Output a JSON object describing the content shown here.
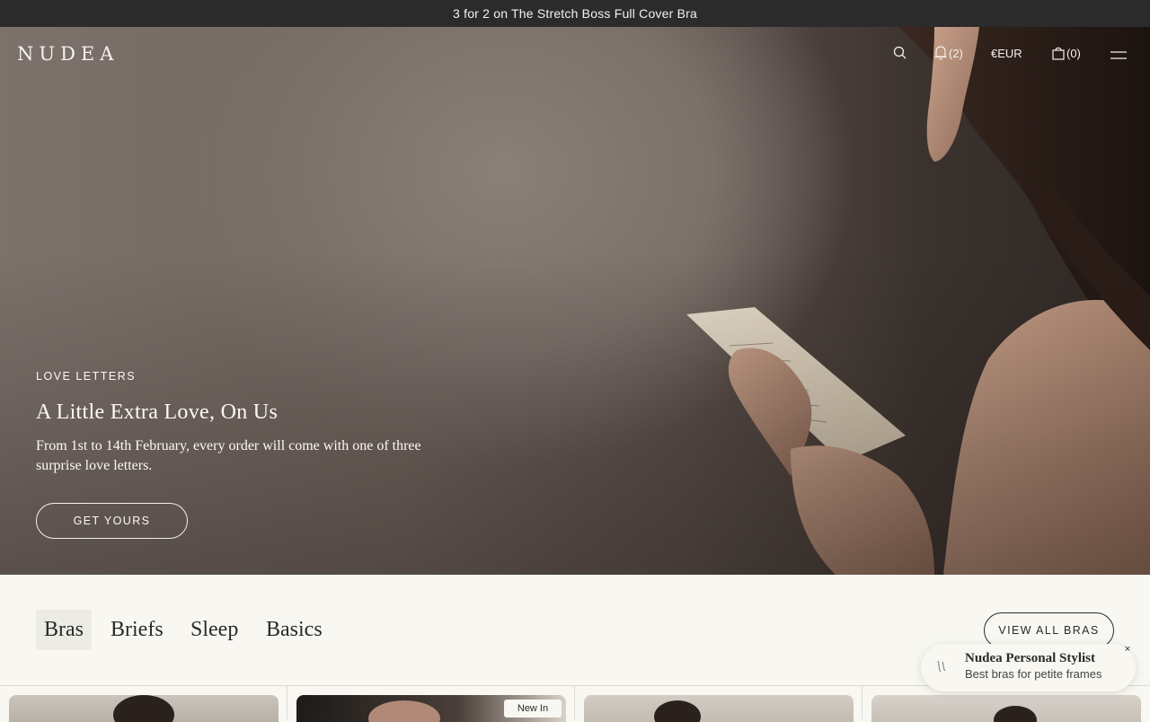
{
  "announcement": {
    "text": "3 for 2 on The Stretch Boss Full Cover Bra"
  },
  "header": {
    "logo": "NUDEA",
    "wishlist_count": "(2)",
    "currency": "€EUR",
    "bag_count": "(0)",
    "icons": [
      "search-icon",
      "bell-icon",
      "bag-icon",
      "menu-icon"
    ]
  },
  "hero": {
    "eyebrow": "LOVE LETTERS",
    "title": "A Little Extra Love, On Us",
    "description": "From 1st to 14th February, every order will come with one of three surprise love letters.",
    "cta_label": "GET YOURS"
  },
  "categories": {
    "tabs": [
      {
        "label": "Bras",
        "active": true
      },
      {
        "label": "Briefs",
        "active": false
      },
      {
        "label": "Sleep",
        "active": false
      },
      {
        "label": "Basics",
        "active": false
      }
    ],
    "view_all_label": "VIEW ALL BRAS"
  },
  "products": {
    "badge": "New In"
  },
  "stylist": {
    "title": "Nudea Personal Stylist",
    "subtitle": "Best bras for petite frames",
    "close_label": "×"
  },
  "colors": {
    "announcement_bg": "#2b2b2b",
    "page_bg": "#f8f7f1",
    "text_dark": "#2a2a2a",
    "hero_text": "#fbf9f6"
  }
}
